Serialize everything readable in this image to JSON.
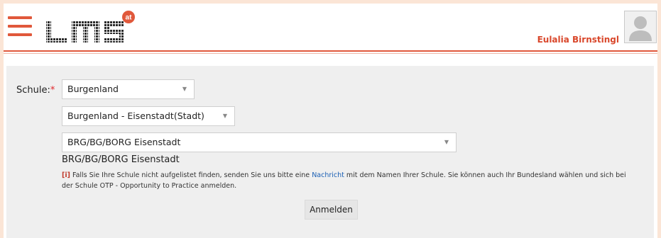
{
  "header": {
    "logo_text": "LMS",
    "logo_badge": "at",
    "user_name": "Eulalia Birnstingl"
  },
  "form": {
    "school_label": "Schule:",
    "required_mark": "*",
    "select_state": "Burgenland",
    "select_district": "Burgenland - Eisenstadt(Stadt)",
    "select_school": "BRG/BG/BORG Eisenstadt",
    "selected_school_text": "BRG/BG/BORG Eisenstadt",
    "info_icon": "[i]",
    "info_before_link": " Falls Sie Ihre Schule nicht aufgelistet finden, senden Sie uns bitte eine ",
    "info_link": "Nachricht",
    "info_after_link": " mit dem Namen Ihrer Schule. Sie können auch Ihr Bundesland wählen und sich bei der Schule OTP - Opportunity to Practice anmelden.",
    "submit_label": "Anmelden"
  },
  "colors": {
    "accent": "#e0583b",
    "username": "#d9472b",
    "background": "#fbe5d6",
    "link": "#1a5fb4"
  }
}
